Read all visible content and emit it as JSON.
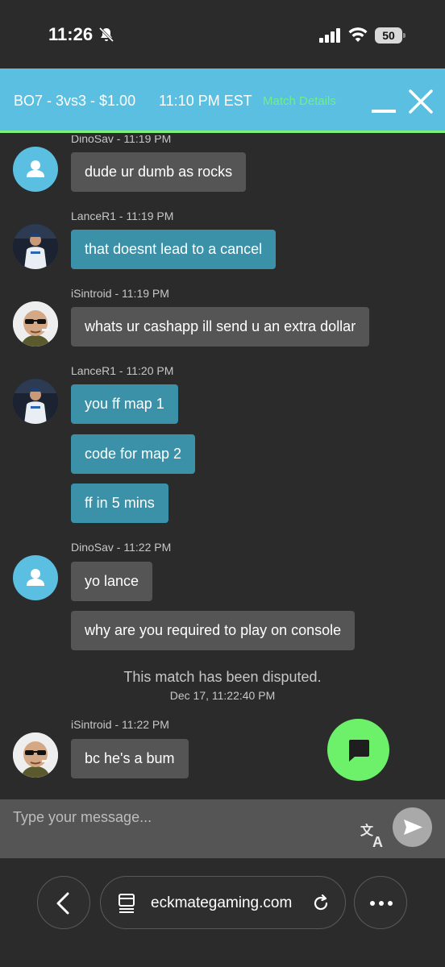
{
  "status_bar": {
    "time": "11:26",
    "battery": "50",
    "icons": [
      "bell-off-icon",
      "signal-icon",
      "wifi-icon",
      "battery-icon"
    ]
  },
  "match_header": {
    "info": "BO7 - 3vs3 - $1.00",
    "time": "11:10 PM EST",
    "details_link": "Match Details",
    "accent_color": "#5bbfe1",
    "link_color": "#6df08a"
  },
  "chat": {
    "messages": [
      {
        "meta": "DinoSav - 11:19 PM",
        "bubbles": [
          "dude ur dumb as rocks"
        ]
      },
      {
        "meta": "LanceR1 - 11:19 PM",
        "bubbles": [
          "that doesnt lead to a cancel"
        ]
      },
      {
        "meta": "iSintroid - 11:19 PM",
        "bubbles": [
          "whats ur cashapp ill send u an extra dollar"
        ]
      },
      {
        "meta": "LanceR1 - 11:20 PM",
        "bubbles": [
          "you ff map 1",
          "code for map 2",
          "ff in 5 mins"
        ]
      },
      {
        "meta": "DinoSav - 11:22 PM",
        "bubbles": [
          "yo lance",
          "why are you required to play on console"
        ]
      },
      {
        "meta": "iSintroid - 11:22 PM",
        "bubbles": [
          "bc he's a bum"
        ]
      }
    ],
    "system_note": {
      "text": "This match has been disputed.",
      "date": "Dec 17, 11:22:40 PM"
    }
  },
  "input": {
    "placeholder": "Type your message..."
  },
  "browser": {
    "url": "eckmategaming.com"
  }
}
